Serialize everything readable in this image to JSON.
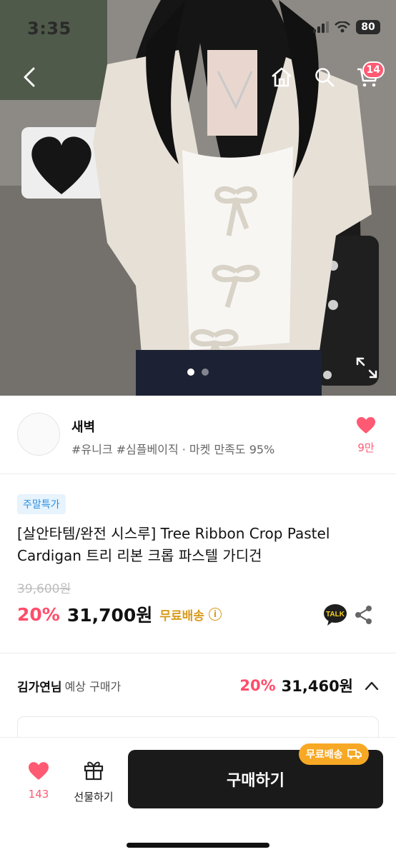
{
  "status_bar": {
    "time": "3:35",
    "battery": "80"
  },
  "header": {
    "cart_count": "14"
  },
  "gallery": {
    "page_count": 2,
    "active_page": 1
  },
  "shop": {
    "name": "새벽",
    "tags": "#유니크 #심플베이직 · 마켓 만족도 95%",
    "like_count": "9만"
  },
  "product": {
    "badge": "주말특가",
    "title": "[살안타템/완전 시스루] Tree Ribbon Crop Pastel Cardigan 트리 리본 크롭 파스텔 가디건",
    "original_price": "39,600원",
    "discount": "20%",
    "price": "31,700원",
    "shipping": "무료배송",
    "talk_label": "TALK"
  },
  "expected": {
    "buyer": "김가연님",
    "label": "예상 구매가",
    "discount": "20%",
    "price": "31,460원"
  },
  "bottom_bar": {
    "like_count": "143",
    "gift_label": "선물하기",
    "buy_label": "구매하기",
    "free_ship_badge": "무료배송"
  },
  "colors": {
    "accent_pink": "#ff5a73",
    "discount_red": "#ff4d6a",
    "shipping_gold": "#d99a1c",
    "badge_blue": "#2b8fe0"
  }
}
